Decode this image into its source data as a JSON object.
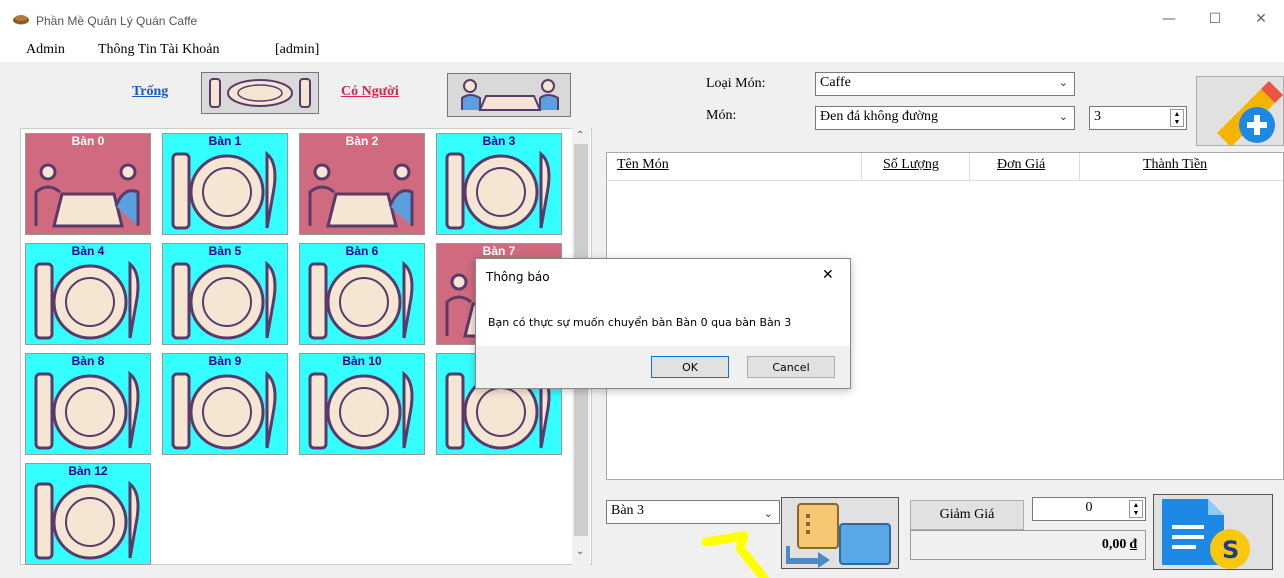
{
  "window": {
    "title": "Phần Mề Quản Lý Quán Caffe"
  },
  "menu": {
    "items": [
      "Admin",
      "Thông Tin Tài Khoản",
      "[admin]"
    ]
  },
  "legend": {
    "free_label": "Trống",
    "busy_label": "Có Người"
  },
  "tables": [
    {
      "name": "Bàn 0",
      "status": "busy"
    },
    {
      "name": "Bàn 1",
      "status": "free"
    },
    {
      "name": "Bàn 2",
      "status": "busy"
    },
    {
      "name": "Bàn 3",
      "status": "free"
    },
    {
      "name": "Bàn 4",
      "status": "free"
    },
    {
      "name": "Bàn 5",
      "status": "free"
    },
    {
      "name": "Bàn 6",
      "status": "free"
    },
    {
      "name": "Bàn 7",
      "status": "busy"
    },
    {
      "name": "Bàn 8",
      "status": "free"
    },
    {
      "name": "Bàn 9",
      "status": "free"
    },
    {
      "name": "Bàn 10",
      "status": "free"
    },
    {
      "name": "",
      "status": "free"
    },
    {
      "name": "Bàn 12",
      "status": "free"
    }
  ],
  "order": {
    "category_label": "Loại Món:",
    "category_value": "Caffe",
    "item_label": "Món:",
    "item_value": "Đen đá không đường",
    "quantity": "3"
  },
  "order_list": {
    "columns": [
      "Tên Món",
      "Số Lượng",
      "Đơn Giá",
      "Thành Tiền"
    ]
  },
  "bottom": {
    "switch_table_value": "Bàn 3",
    "discount_label": "Giảm Giá",
    "discount_value": "0",
    "total": "0,00 ₫"
  },
  "dialog": {
    "title": "Thông báo",
    "message": "Bạn có thực sự muốn chuyển bàn Bàn 0 qua bàn Bàn 3",
    "ok_label": "OK",
    "cancel_label": "Cancel"
  },
  "colors": {
    "free": "#33ffff",
    "busy": "#d06a7e",
    "accent": "#0a57c2"
  }
}
